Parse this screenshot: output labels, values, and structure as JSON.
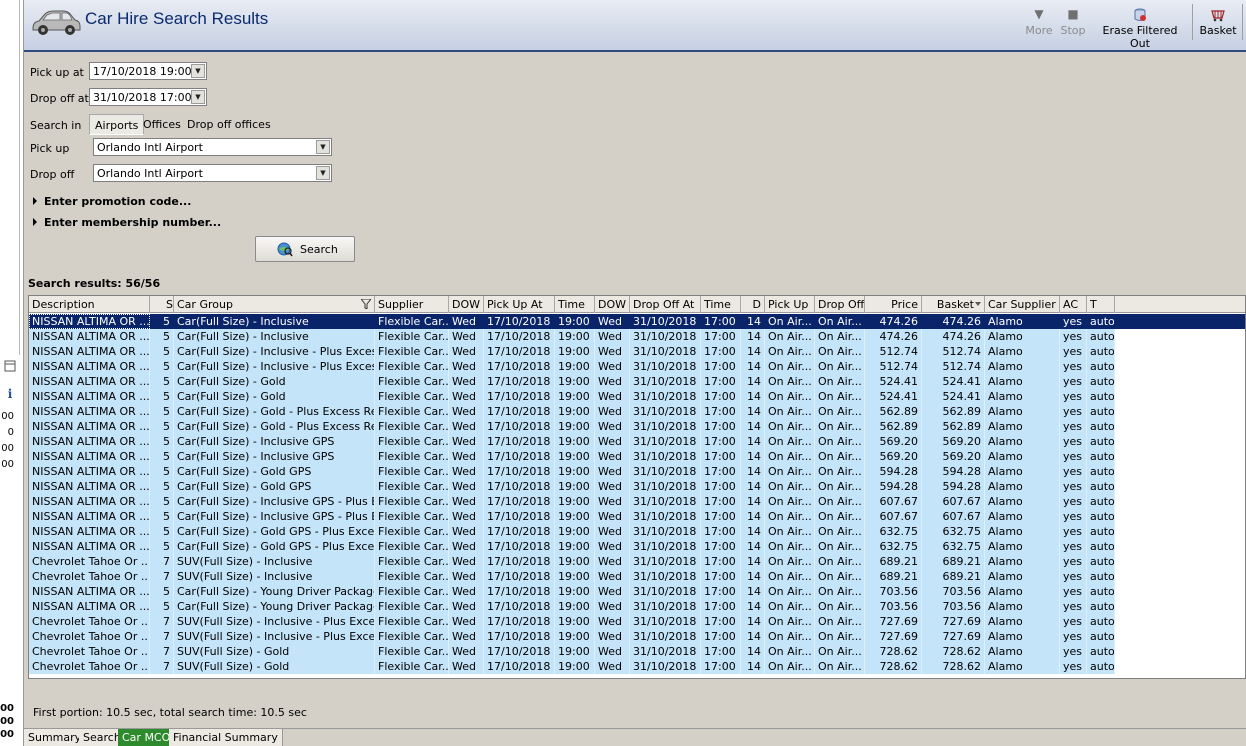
{
  "window": {
    "title": "Car Hire Search Results"
  },
  "toolbar": {
    "more_label": "More",
    "stop_label": "Stop",
    "erase_label": "Erase Filtered Out",
    "basket_label": "Basket"
  },
  "left_strip": {
    "numbers": [
      "00",
      "0",
      "00",
      "00"
    ],
    "bottom_numbers": [
      "00",
      "00",
      "00"
    ]
  },
  "form": {
    "pickup_at_label": "Pick up at",
    "pickup_at_value": "17/10/2018 19:00",
    "dropoff_at_label": "Drop off at",
    "dropoff_at_value": "31/10/2018 17:00",
    "search_in_label": "Search in",
    "search_in_options": [
      "Airports",
      "Offices",
      "Drop off offices"
    ],
    "search_in_selected": "Airports",
    "pickup_label": "Pick up",
    "pickup_value": "Orlando Intl Airport",
    "dropoff_label": "Drop off",
    "dropoff_value": "Orlando Intl Airport",
    "promo_label": "Enter promotion code...",
    "membership_label": "Enter membership number...",
    "search_button": "Search"
  },
  "results": {
    "count_label": "Search results: 56/56",
    "columns": [
      "Description",
      "S",
      "Car Group",
      "Supplier",
      "DOW",
      "Pick Up At",
      "Time",
      "DOW",
      "Drop Off At",
      "Time",
      "D",
      "Pick Up",
      "Drop Off",
      "Price",
      "Basket",
      "Car Supplier",
      "AC",
      "T"
    ],
    "rows": [
      [
        "NISSAN ALTIMA OR ...",
        "5",
        "Car(Full Size) - Inclusive",
        "Flexible Car...",
        "Wed",
        "17/10/2018",
        "19:00",
        "Wed",
        "31/10/2018",
        "17:00",
        "14",
        "On Air...",
        "On Air...",
        "474.26",
        "474.26",
        "Alamo",
        "yes",
        "auto"
      ],
      [
        "NISSAN ALTIMA OR ...",
        "5",
        "Car(Full Size) - Inclusive",
        "Flexible Car...",
        "Wed",
        "17/10/2018",
        "19:00",
        "Wed",
        "31/10/2018",
        "17:00",
        "14",
        "On Air...",
        "On Air...",
        "474.26",
        "474.26",
        "Alamo",
        "yes",
        "auto"
      ],
      [
        "NISSAN ALTIMA OR ...",
        "5",
        "Car(Full Size) - Inclusive - Plus Excess...",
        "Flexible Car...",
        "Wed",
        "17/10/2018",
        "19:00",
        "Wed",
        "31/10/2018",
        "17:00",
        "14",
        "On Air...",
        "On Air...",
        "512.74",
        "512.74",
        "Alamo",
        "yes",
        "auto"
      ],
      [
        "NISSAN ALTIMA OR ...",
        "5",
        "Car(Full Size) - Inclusive - Plus Excess...",
        "Flexible Car...",
        "Wed",
        "17/10/2018",
        "19:00",
        "Wed",
        "31/10/2018",
        "17:00",
        "14",
        "On Air...",
        "On Air...",
        "512.74",
        "512.74",
        "Alamo",
        "yes",
        "auto"
      ],
      [
        "NISSAN ALTIMA OR ...",
        "5",
        "Car(Full Size) - Gold",
        "Flexible Car...",
        "Wed",
        "17/10/2018",
        "19:00",
        "Wed",
        "31/10/2018",
        "17:00",
        "14",
        "On Air...",
        "On Air...",
        "524.41",
        "524.41",
        "Alamo",
        "yes",
        "auto"
      ],
      [
        "NISSAN ALTIMA OR ...",
        "5",
        "Car(Full Size) - Gold",
        "Flexible Car...",
        "Wed",
        "17/10/2018",
        "19:00",
        "Wed",
        "31/10/2018",
        "17:00",
        "14",
        "On Air...",
        "On Air...",
        "524.41",
        "524.41",
        "Alamo",
        "yes",
        "auto"
      ],
      [
        "NISSAN ALTIMA OR ...",
        "5",
        "Car(Full Size) - Gold - Plus Excess Ref...",
        "Flexible Car...",
        "Wed",
        "17/10/2018",
        "19:00",
        "Wed",
        "31/10/2018",
        "17:00",
        "14",
        "On Air...",
        "On Air...",
        "562.89",
        "562.89",
        "Alamo",
        "yes",
        "auto"
      ],
      [
        "NISSAN ALTIMA OR ...",
        "5",
        "Car(Full Size) - Gold - Plus Excess Ref...",
        "Flexible Car...",
        "Wed",
        "17/10/2018",
        "19:00",
        "Wed",
        "31/10/2018",
        "17:00",
        "14",
        "On Air...",
        "On Air...",
        "562.89",
        "562.89",
        "Alamo",
        "yes",
        "auto"
      ],
      [
        "NISSAN ALTIMA OR ...",
        "5",
        "Car(Full Size) - Inclusive GPS",
        "Flexible Car...",
        "Wed",
        "17/10/2018",
        "19:00",
        "Wed",
        "31/10/2018",
        "17:00",
        "14",
        "On Air...",
        "On Air...",
        "569.20",
        "569.20",
        "Alamo",
        "yes",
        "auto"
      ],
      [
        "NISSAN ALTIMA OR ...",
        "5",
        "Car(Full Size) - Inclusive GPS",
        "Flexible Car...",
        "Wed",
        "17/10/2018",
        "19:00",
        "Wed",
        "31/10/2018",
        "17:00",
        "14",
        "On Air...",
        "On Air...",
        "569.20",
        "569.20",
        "Alamo",
        "yes",
        "auto"
      ],
      [
        "NISSAN ALTIMA OR ...",
        "5",
        "Car(Full Size) - Gold GPS",
        "Flexible Car...",
        "Wed",
        "17/10/2018",
        "19:00",
        "Wed",
        "31/10/2018",
        "17:00",
        "14",
        "On Air...",
        "On Air...",
        "594.28",
        "594.28",
        "Alamo",
        "yes",
        "auto"
      ],
      [
        "NISSAN ALTIMA OR ...",
        "5",
        "Car(Full Size) - Gold GPS",
        "Flexible Car...",
        "Wed",
        "17/10/2018",
        "19:00",
        "Wed",
        "31/10/2018",
        "17:00",
        "14",
        "On Air...",
        "On Air...",
        "594.28",
        "594.28",
        "Alamo",
        "yes",
        "auto"
      ],
      [
        "NISSAN ALTIMA OR ...",
        "5",
        "Car(Full Size) - Inclusive GPS - Plus Ex...",
        "Flexible Car...",
        "Wed",
        "17/10/2018",
        "19:00",
        "Wed",
        "31/10/2018",
        "17:00",
        "14",
        "On Air...",
        "On Air...",
        "607.67",
        "607.67",
        "Alamo",
        "yes",
        "auto"
      ],
      [
        "NISSAN ALTIMA OR ...",
        "5",
        "Car(Full Size) - Inclusive GPS - Plus Ex...",
        "Flexible Car...",
        "Wed",
        "17/10/2018",
        "19:00",
        "Wed",
        "31/10/2018",
        "17:00",
        "14",
        "On Air...",
        "On Air...",
        "607.67",
        "607.67",
        "Alamo",
        "yes",
        "auto"
      ],
      [
        "NISSAN ALTIMA OR ...",
        "5",
        "Car(Full Size) - Gold GPS - Plus Excess...",
        "Flexible Car...",
        "Wed",
        "17/10/2018",
        "19:00",
        "Wed",
        "31/10/2018",
        "17:00",
        "14",
        "On Air...",
        "On Air...",
        "632.75",
        "632.75",
        "Alamo",
        "yes",
        "auto"
      ],
      [
        "NISSAN ALTIMA OR ...",
        "5",
        "Car(Full Size) - Gold GPS - Plus Excess...",
        "Flexible Car...",
        "Wed",
        "17/10/2018",
        "19:00",
        "Wed",
        "31/10/2018",
        "17:00",
        "14",
        "On Air...",
        "On Air...",
        "632.75",
        "632.75",
        "Alamo",
        "yes",
        "auto"
      ],
      [
        "Chevrolet Tahoe Or ...",
        "7",
        "SUV(Full Size) - Inclusive",
        "Flexible Car...",
        "Wed",
        "17/10/2018",
        "19:00",
        "Wed",
        "31/10/2018",
        "17:00",
        "14",
        "On Air...",
        "On Air...",
        "689.21",
        "689.21",
        "Alamo",
        "yes",
        "auto"
      ],
      [
        "Chevrolet Tahoe Or ...",
        "7",
        "SUV(Full Size) - Inclusive",
        "Flexible Car...",
        "Wed",
        "17/10/2018",
        "19:00",
        "Wed",
        "31/10/2018",
        "17:00",
        "14",
        "On Air...",
        "On Air...",
        "689.21",
        "689.21",
        "Alamo",
        "yes",
        "auto"
      ],
      [
        "NISSAN ALTIMA OR ...",
        "5",
        "Car(Full Size) - Young Driver Package ...",
        "Flexible Car...",
        "Wed",
        "17/10/2018",
        "19:00",
        "Wed",
        "31/10/2018",
        "17:00",
        "14",
        "On Air...",
        "On Air...",
        "703.56",
        "703.56",
        "Alamo",
        "yes",
        "auto"
      ],
      [
        "NISSAN ALTIMA OR ...",
        "5",
        "Car(Full Size) - Young Driver Package ...",
        "Flexible Car...",
        "Wed",
        "17/10/2018",
        "19:00",
        "Wed",
        "31/10/2018",
        "17:00",
        "14",
        "On Air...",
        "On Air...",
        "703.56",
        "703.56",
        "Alamo",
        "yes",
        "auto"
      ],
      [
        "Chevrolet Tahoe Or ...",
        "7",
        "SUV(Full Size) - Inclusive - Plus Excess...",
        "Flexible Car...",
        "Wed",
        "17/10/2018",
        "19:00",
        "Wed",
        "31/10/2018",
        "17:00",
        "14",
        "On Air...",
        "On Air...",
        "727.69",
        "727.69",
        "Alamo",
        "yes",
        "auto"
      ],
      [
        "Chevrolet Tahoe Or ...",
        "7",
        "SUV(Full Size) - Inclusive - Plus Excess...",
        "Flexible Car...",
        "Wed",
        "17/10/2018",
        "19:00",
        "Wed",
        "31/10/2018",
        "17:00",
        "14",
        "On Air...",
        "On Air...",
        "727.69",
        "727.69",
        "Alamo",
        "yes",
        "auto"
      ],
      [
        "Chevrolet Tahoe Or ...",
        "7",
        "SUV(Full Size) - Gold",
        "Flexible Car...",
        "Wed",
        "17/10/2018",
        "19:00",
        "Wed",
        "31/10/2018",
        "17:00",
        "14",
        "On Air...",
        "On Air...",
        "728.62",
        "728.62",
        "Alamo",
        "yes",
        "auto"
      ],
      [
        "Chevrolet Tahoe Or ...",
        "7",
        "SUV(Full Size) - Gold",
        "Flexible Car...",
        "Wed",
        "17/10/2018",
        "19:00",
        "Wed",
        "31/10/2018",
        "17:00",
        "14",
        "On Air...",
        "On Air...",
        "728.62",
        "728.62",
        "Alamo",
        "yes",
        "auto"
      ]
    ],
    "selected_row": 0
  },
  "status": {
    "text": "First portion: 10.5 sec, total search time: 10.5 sec"
  },
  "bottom_tabs": [
    "Summary",
    "Search",
    "Car MCO",
    "Financial Summary"
  ],
  "bottom_tab_active": "Car MCO",
  "colors": {
    "header_text": "#0c2a6e",
    "row_bg": "#c4e4fa",
    "selected_row_bg": "#0a246a",
    "active_tab_bg": "#2d8a2d"
  }
}
